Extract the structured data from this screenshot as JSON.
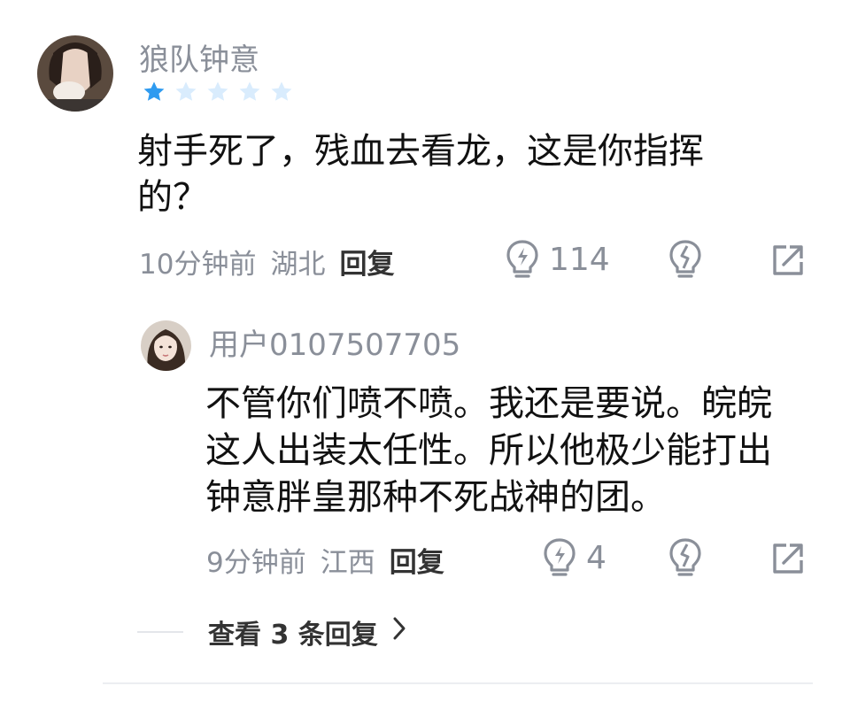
{
  "comment": {
    "username": "狼队钟意",
    "rating": 1,
    "rating_max": 5,
    "colors": {
      "star_filled": "#2f9bf0",
      "star_empty": "#d9ecfd"
    },
    "text_line1": "射手死了，残血去看龙，这是你指挥",
    "text_line2": "的？",
    "time": "10分钟前",
    "location": "湖北",
    "reply_label": "回复",
    "like_count": "114",
    "icons": {
      "like": "lightbulb-icon",
      "dislike": "lightbulb-broken-icon",
      "share": "share-icon"
    }
  },
  "reply": {
    "username": "用户0107507705",
    "text_line1": "不管你们喷不喷。我还是要说。皖皖",
    "text_line2": "这人出装太任性。所以他极少能打出",
    "text_line3": "钟意胖皇那种不死战神的团。",
    "time": "9分钟前",
    "location": "江西",
    "reply_label": "回复",
    "like_count": "4"
  },
  "view_replies": {
    "label": "查看 3 条回复",
    "icon": "chevron-right-icon"
  }
}
